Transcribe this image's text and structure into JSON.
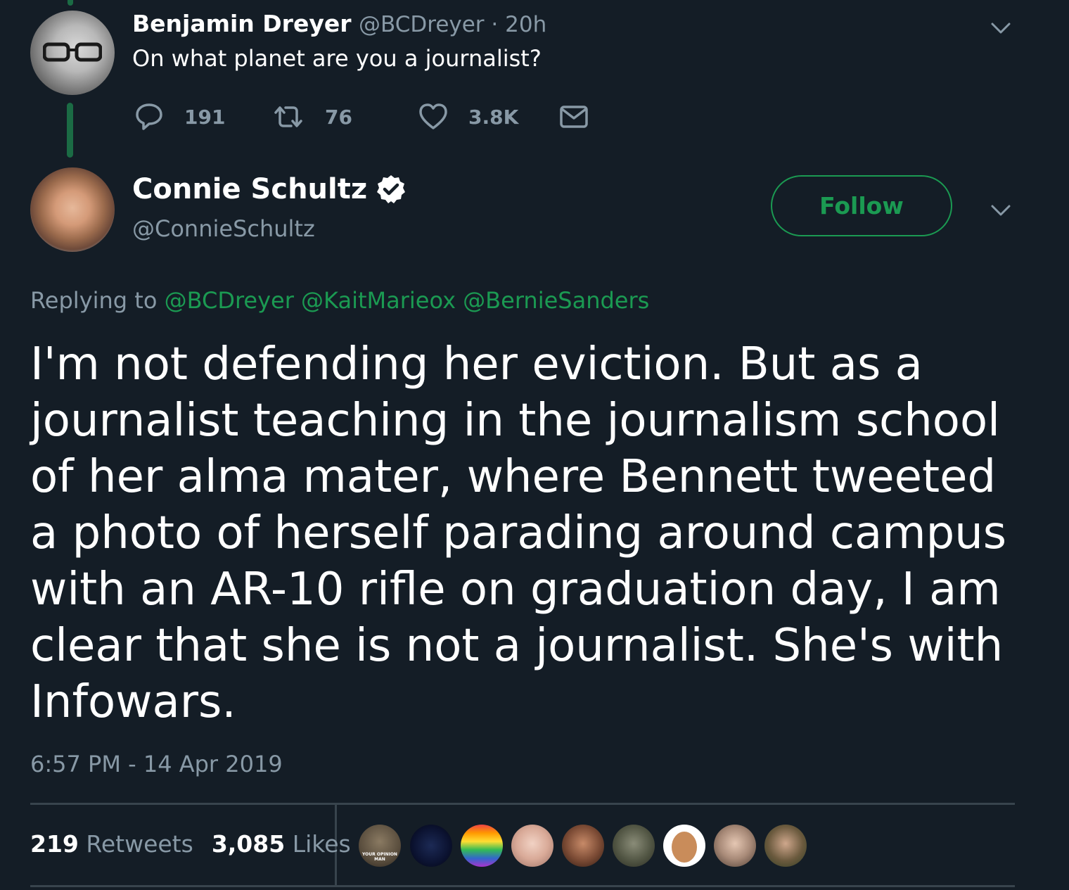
{
  "parent_tweet": {
    "display_name": "Benjamin Dreyer",
    "handle": "@BCDreyer",
    "time_sep": " · ",
    "time": "20h",
    "text": "On what planet are you a journalist?",
    "replies": "191",
    "retweets": "76",
    "likes": "3.8K"
  },
  "main_tweet": {
    "display_name": "Connie Schultz",
    "handle": "@ConnieSchultz",
    "follow_label": "Follow",
    "replying_prefix": "Replying to",
    "replying_to": [
      "@BCDreyer",
      "@KaitMarieox",
      "@BernieSanders"
    ],
    "text": "I'm not defending her eviction. But as a journalist teaching in the journalism school of her alma mater, where Bennett tweeted a photo of herself parading around campus with an AR-10 rifle on graduation day, I am clear that she is not a journalist. She's with Infowars.",
    "timestamp": "6:57 PM - 14 Apr 2019",
    "retweet_count": "219",
    "retweet_label": "Retweets",
    "like_count": "3,085",
    "like_label": "Likes"
  },
  "liker_avatar_text": [
    "YOUR OPINION",
    "MAN"
  ],
  "colors": {
    "background": "#141d26",
    "accent": "#1b9a52",
    "muted": "#8899a6",
    "divider": "#38444d"
  },
  "icons": [
    "reply-icon",
    "retweet-icon",
    "like-icon",
    "dm-icon",
    "chevron-down-icon",
    "verified-badge-icon"
  ]
}
